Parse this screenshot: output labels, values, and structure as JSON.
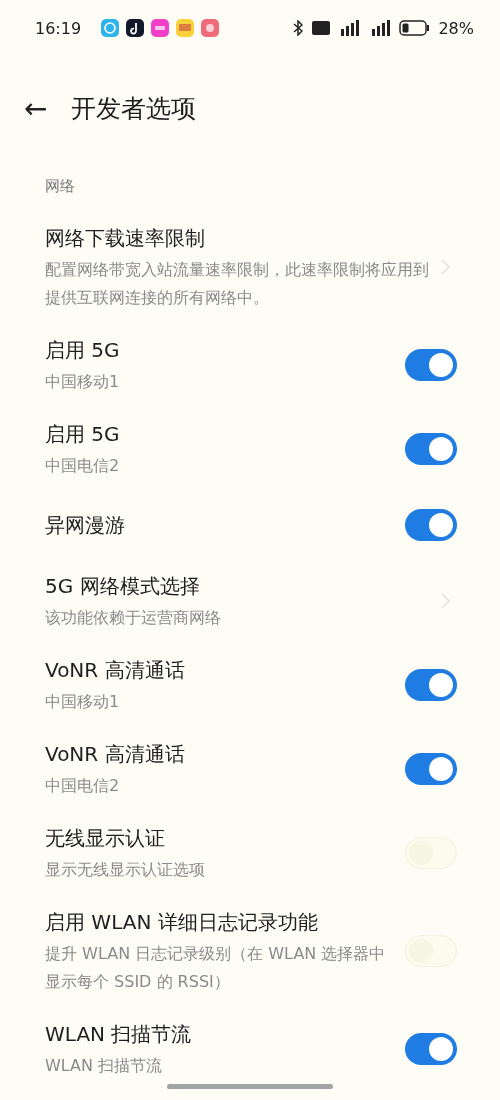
{
  "status_bar": {
    "time": "16:19",
    "battery": "28%"
  },
  "header": {
    "back": "←",
    "title": "开发者选项"
  },
  "section": "网络",
  "items": [
    {
      "kind": "link",
      "title": "网络下载速率限制",
      "subtitle": "配置网络带宽入站流量速率限制，此速率限制将应用到提供互联网连接的所有网络中。"
    },
    {
      "kind": "toggle",
      "title": "启用 5G",
      "subtitle": "中国移动1",
      "on": true
    },
    {
      "kind": "toggle",
      "title": "启用 5G",
      "subtitle": "中国电信2",
      "on": true
    },
    {
      "kind": "toggle",
      "title": "异网漫游",
      "on": true
    },
    {
      "kind": "link",
      "title": "5G 网络模式选择",
      "subtitle": "该功能依赖于运营商网络"
    },
    {
      "kind": "toggle",
      "title": "VoNR 高清通话",
      "subtitle": "中国移动1",
      "on": true
    },
    {
      "kind": "toggle",
      "title": "VoNR 高清通话",
      "subtitle": "中国电信2",
      "on": true
    },
    {
      "kind": "toggle",
      "title": "无线显示认证",
      "subtitle": "显示无线显示认证选项",
      "on": false
    },
    {
      "kind": "toggle",
      "title": "启用 WLAN 详细日志记录功能",
      "subtitle": "提升 WLAN 日志记录级别（在 WLAN 选择器中显示每个 SSID 的 RSSI）",
      "on": false
    },
    {
      "kind": "toggle",
      "title": "WLAN 扫描节流",
      "subtitle": "WLAN 扫描节流",
      "on": true
    }
  ]
}
